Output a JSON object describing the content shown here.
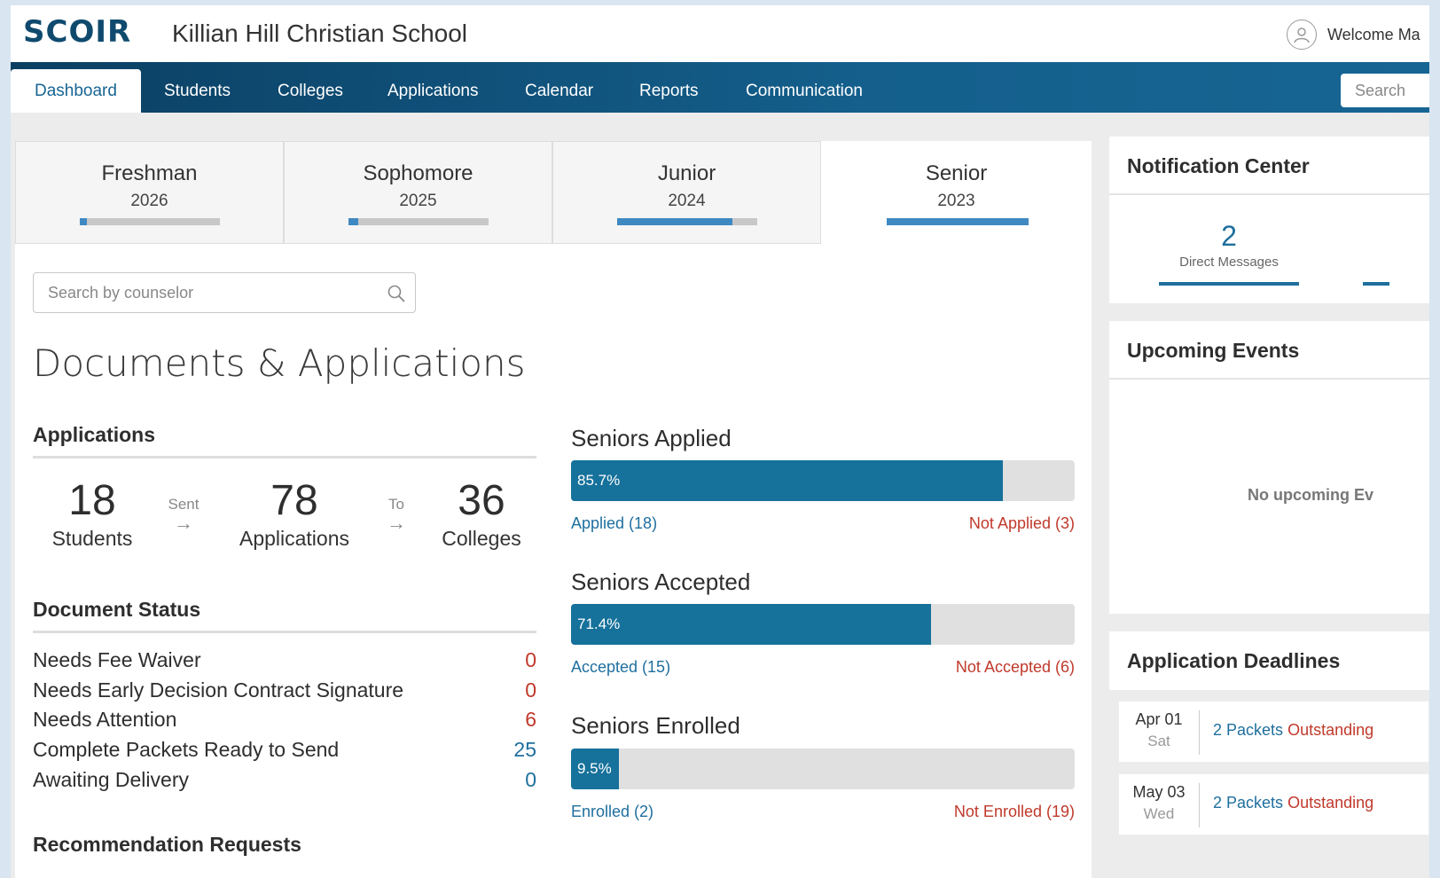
{
  "header": {
    "logo": "SCOIR",
    "school_name": "Killian Hill Christian School",
    "welcome": "Welcome Ma"
  },
  "nav": {
    "tabs": [
      "Dashboard",
      "Students",
      "Colleges",
      "Applications",
      "Calendar",
      "Reports",
      "Communication"
    ],
    "active": "Dashboard",
    "search_placeholder": "Search"
  },
  "grades": [
    {
      "name": "Freshman",
      "year": "2026",
      "progress": 0.05
    },
    {
      "name": "Sophomore",
      "year": "2025",
      "progress": 0.07
    },
    {
      "name": "Junior",
      "year": "2024",
      "progress": 0.82
    },
    {
      "name": "Senior",
      "year": "2023",
      "progress": 1.0
    }
  ],
  "counselor_search": {
    "placeholder": "Search by counselor"
  },
  "section_title": "Documents & Applications",
  "applications": {
    "heading": "Applications",
    "students": {
      "value": "18",
      "label": "Students"
    },
    "sent_label": "Sent",
    "applications": {
      "value": "78",
      "label": "Applications"
    },
    "to_label": "To",
    "colleges": {
      "value": "36",
      "label": "Colleges"
    }
  },
  "document_status": {
    "heading": "Document Status",
    "rows": [
      {
        "label": "Needs Fee Waiver",
        "value": "0"
      },
      {
        "label": "Needs Early Decision Contract Signature",
        "value": "0"
      },
      {
        "label": "Needs Attention",
        "value": "6"
      },
      {
        "label": "Complete Packets Ready to Send",
        "value": "25"
      },
      {
        "label": "Awaiting Delivery",
        "value": "0"
      }
    ]
  },
  "recommendation_heading": "Recommendation Requests",
  "senior_bars": [
    {
      "title": "Seniors Applied",
      "percent": 85.7,
      "percent_label": "85.7%",
      "left": "Applied (18)",
      "right": "Not Applied (3)"
    },
    {
      "title": "Seniors Accepted",
      "percent": 71.4,
      "percent_label": "71.4%",
      "left": "Accepted (15)",
      "right": "Not Accepted (6)"
    },
    {
      "title": "Seniors Enrolled",
      "percent": 9.5,
      "percent_label": "9.5%",
      "left": "Enrolled (2)",
      "right": "Not Enrolled (19)"
    }
  ],
  "notification_center": {
    "title": "Notification Center",
    "direct_messages_count": "2",
    "direct_messages_label": "Direct Messages"
  },
  "upcoming_events": {
    "title": "Upcoming Events",
    "empty_text": "No upcoming Ev"
  },
  "application_deadlines": {
    "title": "Application Deadlines",
    "rows": [
      {
        "date": "Apr 01",
        "weekday": "Sat",
        "count": "2 Packets",
        "status": "Outstanding"
      },
      {
        "date": "May 03",
        "weekday": "Wed",
        "count": "2 Packets",
        "status": "Outstanding"
      }
    ]
  },
  "colors": {
    "nav_dark": "#0b3f62",
    "nav_light": "#176593",
    "accent_blue": "#1f6f9e",
    "bar_fill": "#16719b",
    "alert_red": "#c0392b"
  }
}
